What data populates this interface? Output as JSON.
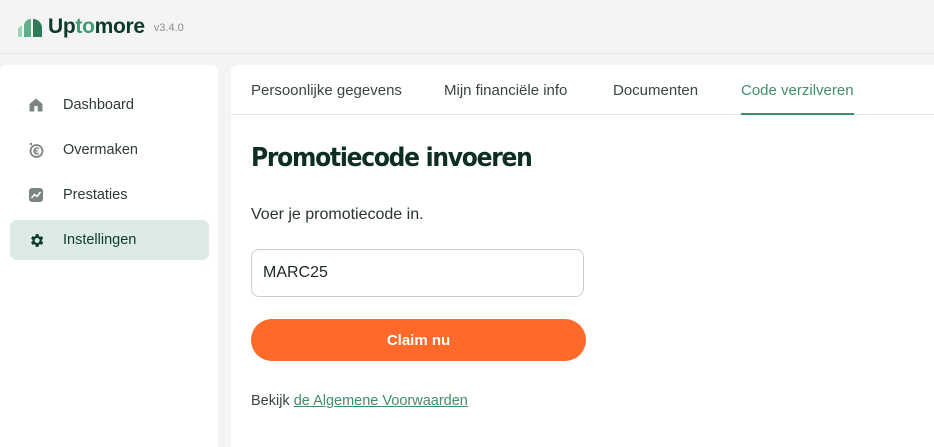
{
  "app": {
    "name_prefix": "Up",
    "name_accent": "to",
    "name_suffix": "more",
    "version": "v3.4.0"
  },
  "sidebar": {
    "items": [
      {
        "label": "Dashboard",
        "icon": "home-icon",
        "active": false
      },
      {
        "label": "Overmaken",
        "icon": "euro-transfer-icon",
        "active": false
      },
      {
        "label": "Prestaties",
        "icon": "chart-icon",
        "active": false
      },
      {
        "label": "Instellingen",
        "icon": "gear-icon",
        "active": true
      }
    ]
  },
  "tabs": [
    {
      "label": "Persoonlijke gegevens",
      "active": false
    },
    {
      "label": "Mijn financiële info",
      "active": false
    },
    {
      "label": "Documenten",
      "active": false
    },
    {
      "label": "Code verzilveren",
      "active": true
    }
  ],
  "main": {
    "title": "Promotiecode invoeren",
    "subtitle": "Voer je promotiecode in.",
    "code_value": "MARC25",
    "claim_label": "Claim nu",
    "terms_prefix": "Bekijk",
    "terms_link": "de Algemene Voorwaarden"
  },
  "colors": {
    "brand_dark": "#0c3b2e",
    "brand_green": "#3f8f6a",
    "active_nav_bg": "#dcebe4",
    "cta_orange": "#ff6a2a"
  }
}
